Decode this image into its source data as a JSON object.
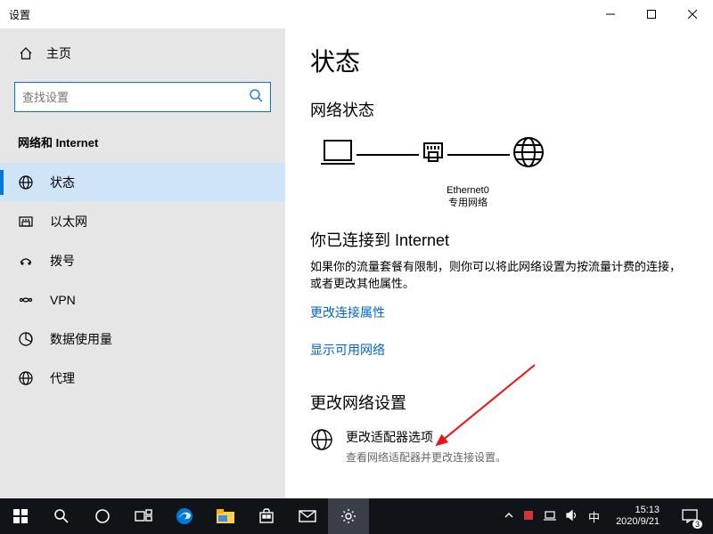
{
  "window_title": "设置",
  "sidebar": {
    "home": "主页",
    "search_placeholder": "查找设置",
    "section": "网络和 Internet",
    "items": [
      {
        "label": "状态"
      },
      {
        "label": "以太网"
      },
      {
        "label": "拨号"
      },
      {
        "label": "VPN"
      },
      {
        "label": "数据使用量"
      },
      {
        "label": "代理"
      }
    ]
  },
  "main": {
    "heading": "状态",
    "subheading": "网络状态",
    "diagram_label_line1": "Ethernet0",
    "diagram_label_line2": "专用网络",
    "connected_title": "你已连接到 Internet",
    "connected_desc": "如果你的流量套餐有限制，则你可以将此网络设置为按流量计费的连接，或者更改其他属性。",
    "link_change_conn": "更改连接属性",
    "link_show_net": "显示可用网络",
    "change_section": "更改网络设置",
    "adapter_title": "更改适配器选项",
    "adapter_sub": "查看网络适配器并更改连接设置。"
  },
  "taskbar": {
    "ime": "中",
    "time": "15:13",
    "date": "2020/9/21",
    "notif_count": "3"
  }
}
